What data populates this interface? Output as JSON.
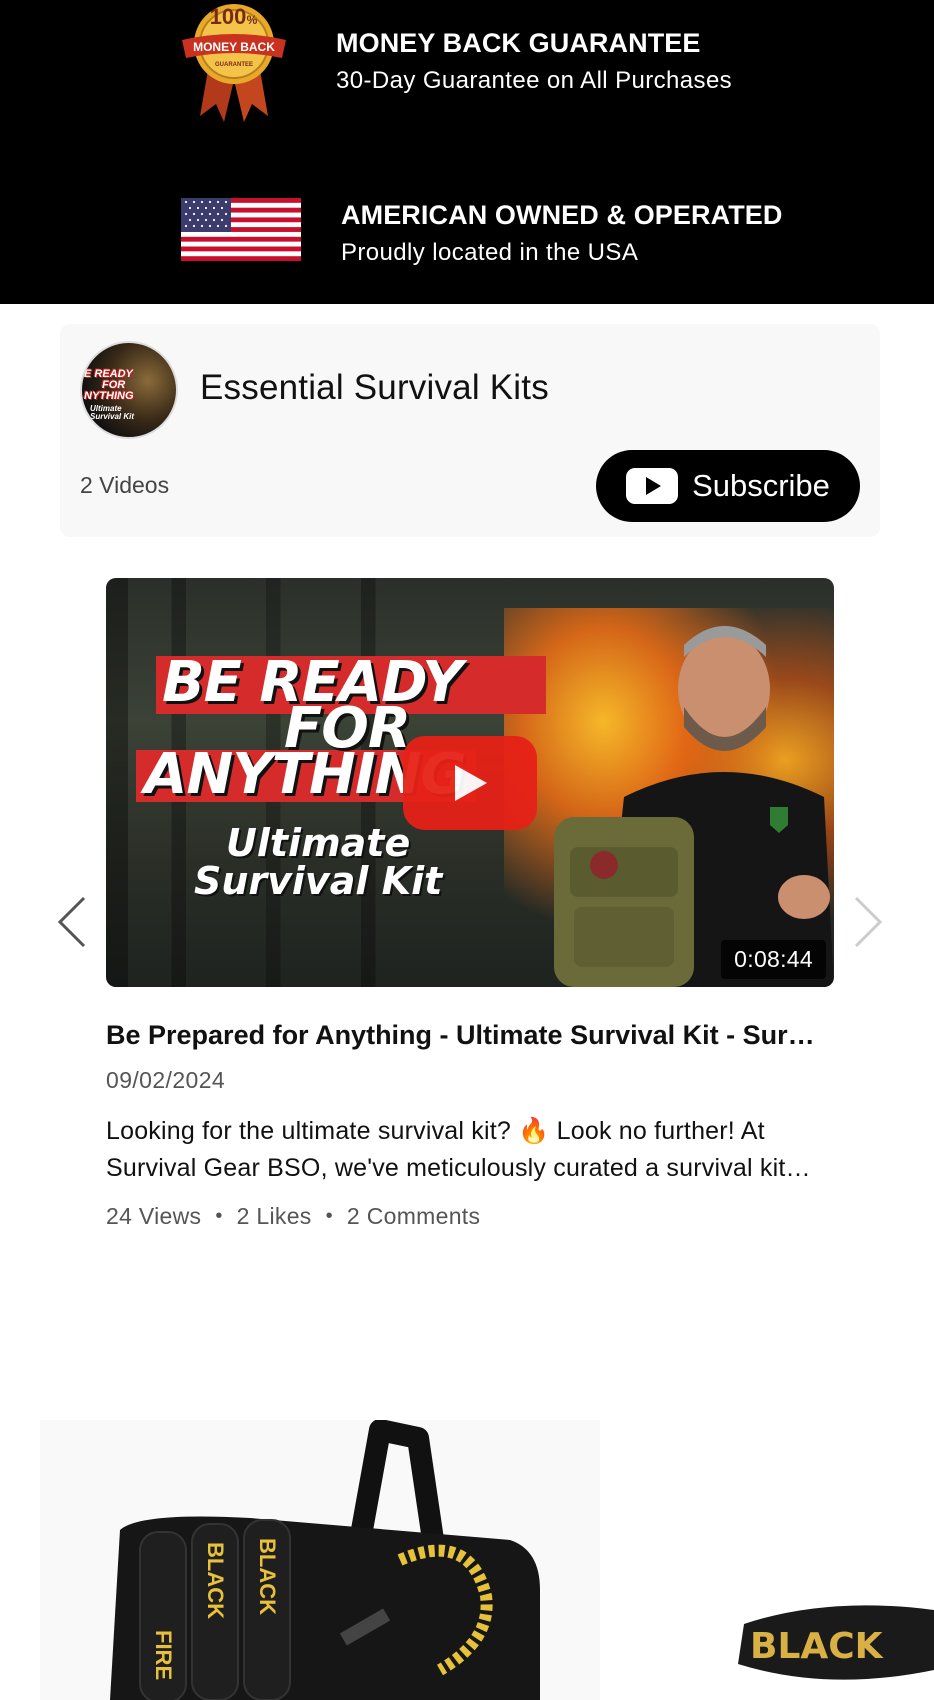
{
  "trust": {
    "guarantee": {
      "badge_top": "100",
      "badge_pct": "%",
      "badge_ribbon": "MONEY BACK",
      "badge_small": "GUARANTEE",
      "title": "MONEY BACK GUARANTEE",
      "subtitle": "30-Day Guarantee on All Purchases"
    },
    "american": {
      "title": "AMERICAN OWNED & OPERATED",
      "subtitle": "Proudly located in the USA"
    }
  },
  "channel": {
    "avatar_line1": "E READY",
    "avatar_line2": "FOR",
    "avatar_line3": "NYTHING",
    "avatar_sub1": "Ultimate",
    "avatar_sub2": "Survival Kit",
    "name": "Essential Survival Kits",
    "video_count": "2 Videos",
    "subscribe_label": "Subscribe"
  },
  "video": {
    "thumb_line1": "BE READY",
    "thumb_line2": "FOR",
    "thumb_line3": "ANYTHING",
    "thumb_sub1": "Ultimate",
    "thumb_sub2": "Survival Kit",
    "duration": "0:08:44",
    "title": "Be Prepared for Anything - Ultimate Survival Kit - Survival Gear BSO",
    "date": "09/02/2024",
    "description": "Looking for the ultimate survival kit? 🔥 Look no further! At Survival Gear BSO, we've meticulously curated a survival kit with everything you need.",
    "views": "24 Views",
    "likes": "2 Likes",
    "comments": "2 Comments",
    "separator": "•"
  },
  "products": {
    "product1_labels": [
      "FIRE",
      "BLACK",
      "BLACK"
    ],
    "product2_label": "BLACK"
  },
  "icons": {
    "prev": "chevron-left-icon",
    "next": "chevron-right-icon",
    "play": "play-icon",
    "youtube": "youtube-icon"
  },
  "colors": {
    "banner_bg": "#000000",
    "card_bg": "#f8f8f8",
    "play_red": "#e62117",
    "subscribe_bg": "#000000"
  }
}
